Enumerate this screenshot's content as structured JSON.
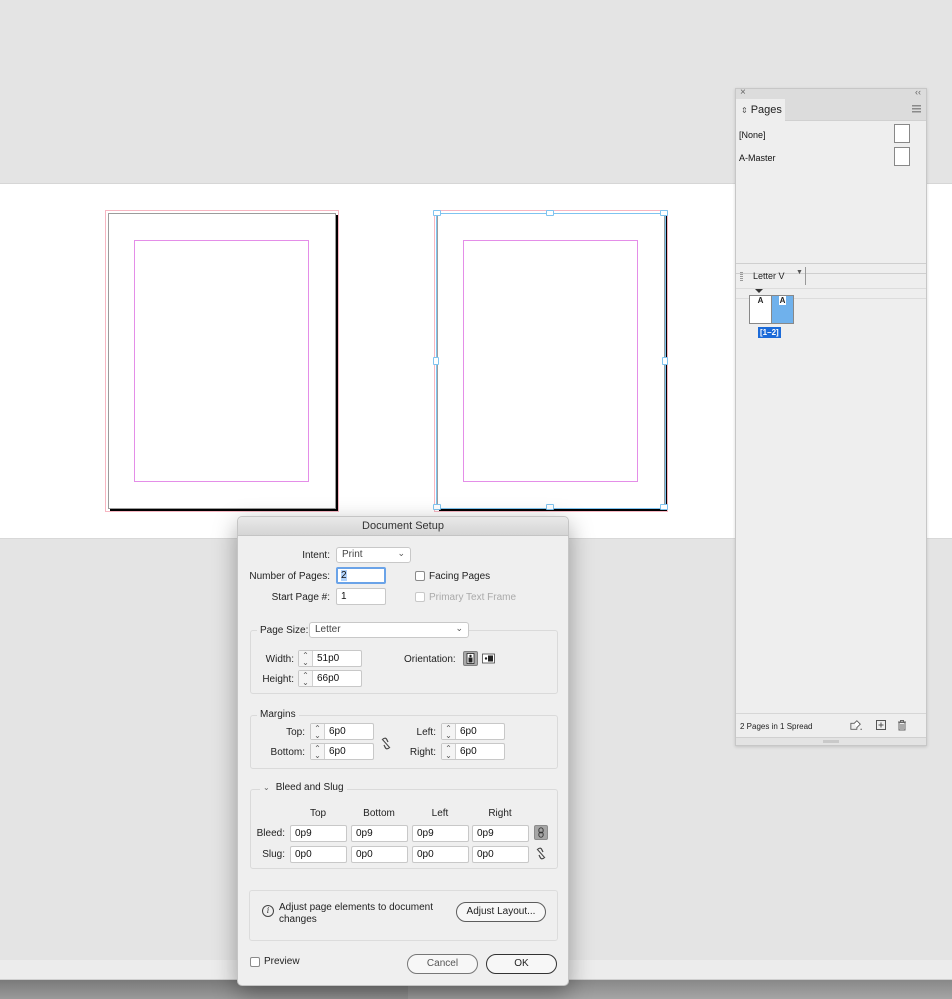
{
  "pages_panel": {
    "close_glyph": "×",
    "collapse_glyph": "‹‹",
    "tab_label": "Pages",
    "tab_glyph": "⇕",
    "masters": [
      {
        "label": "[None]"
      },
      {
        "label": "A-Master"
      }
    ],
    "layout_select": "Letter V",
    "thumb_letters": [
      "A",
      "A"
    ],
    "spread_label": "[1–2]",
    "status": "2 Pages in 1 Spread",
    "icons": [
      "edit-page-size-icon",
      "new-page-icon",
      "delete-page-icon"
    ]
  },
  "dialog": {
    "title": "Document Setup",
    "intent": {
      "label": "Intent:",
      "value": "Print"
    },
    "num_pages": {
      "label": "Number of Pages:",
      "value": "2"
    },
    "start_page": {
      "label": "Start Page #:",
      "value": "1"
    },
    "facing_pages": {
      "label": "Facing Pages",
      "checked": false
    },
    "primary_text_frame": {
      "label": "Primary Text Frame",
      "checked": false,
      "enabled": false
    },
    "page_size": {
      "label": "Page Size:",
      "value": "Letter"
    },
    "width": {
      "label": "Width:",
      "value": "51p0"
    },
    "height": {
      "label": "Height:",
      "value": "66p0"
    },
    "orientation": {
      "label": "Orientation:",
      "selected": "portrait"
    },
    "margins": {
      "title": "Margins",
      "top": {
        "label": "Top:",
        "value": "6p0"
      },
      "bottom": {
        "label": "Bottom:",
        "value": "6p0"
      },
      "left": {
        "label": "Left:",
        "value": "6p0"
      },
      "right": {
        "label": "Right:",
        "value": "6p0"
      },
      "linked": false
    },
    "bleed_slug": {
      "title": "Bleed and Slug",
      "expanded": true,
      "columns": [
        "Top",
        "Bottom",
        "Left",
        "Right"
      ],
      "bleed": {
        "label": "Bleed:",
        "values": [
          "0p9",
          "0p9",
          "0p9",
          "0p9"
        ],
        "linked": true
      },
      "slug": {
        "label": "Slug:",
        "values": [
          "0p0",
          "0p0",
          "0p0",
          "0p0"
        ],
        "linked": false
      }
    },
    "adjust": {
      "text": "Adjust page elements to document changes",
      "text_line1": "Adjust page elements to document",
      "text_line2": "changes",
      "button": "Adjust Layout..."
    },
    "preview": {
      "label": "Preview",
      "checked": false
    },
    "cancel": "Cancel",
    "ok": "OK"
  },
  "colors": {
    "margin_guide": "#e48ee8",
    "bleed_guide": "#f7b6c2",
    "selection": "#7fc4f0",
    "spread_selected": "#1b6ad8",
    "focus_ring": "#6aa3e8"
  }
}
